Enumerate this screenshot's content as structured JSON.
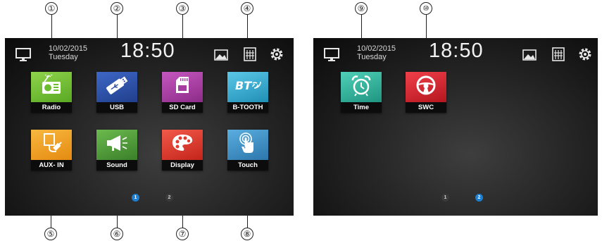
{
  "callouts": [
    "①",
    "②",
    "③",
    "④",
    "⑤",
    "⑥",
    "⑦",
    "⑧",
    "⑨",
    "⑩"
  ],
  "screen1": {
    "date": "10/02/2015",
    "day": "Tuesday",
    "time": "18:50",
    "tiles": [
      {
        "label": "Radio",
        "color": "#6dbb2e",
        "icon": "radio-icon"
      },
      {
        "label": "USB",
        "color": "#2b4fa5",
        "icon": "usb-icon"
      },
      {
        "label": "SD Card",
        "color": "#a63ca0",
        "icon": "sd-card-icon"
      },
      {
        "label": "B-TOOTH",
        "color": "#2ea7cc",
        "icon": "bluetooth-icon"
      },
      {
        "label": "AUX- IN",
        "color": "#f2a21a",
        "icon": "aux-in-icon"
      },
      {
        "label": "Sound",
        "color": "#4e9a3a",
        "icon": "megaphone-icon"
      },
      {
        "label": "Display",
        "color": "#e33a2e",
        "icon": "palette-icon"
      },
      {
        "label": "Touch",
        "color": "#3f92c9",
        "icon": "touch-icon"
      }
    ],
    "pages": [
      "1",
      "2"
    ],
    "active_page": "1"
  },
  "screen2": {
    "date": "10/02/2015",
    "day": "Tuesday",
    "time": "18:50",
    "tiles": [
      {
        "label": "Time",
        "color": "#2fb19a",
        "icon": "alarm-clock-icon"
      },
      {
        "label": "SWC",
        "color": "#d9232f",
        "icon": "steering-wheel-icon"
      }
    ],
    "pages": [
      "1",
      "2"
    ],
    "active_page": "2"
  }
}
